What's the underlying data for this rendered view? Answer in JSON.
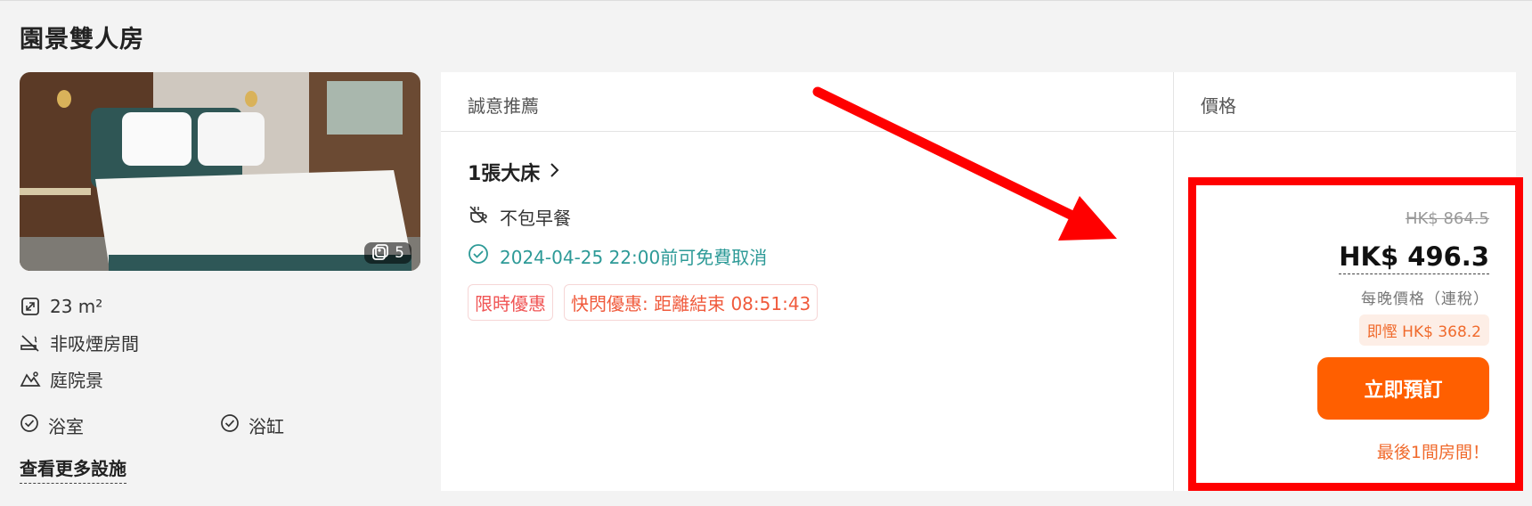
{
  "room": {
    "title": "園景雙人房",
    "photo_count": "5"
  },
  "features": [
    {
      "icon": "area-icon",
      "label": "23 m²"
    },
    {
      "icon": "no-smoking-icon",
      "label": "非吸煙房間"
    },
    {
      "icon": "garden-view-icon",
      "label": "庭院景"
    }
  ],
  "amenities": [
    {
      "icon": "check-circle-icon",
      "label": "浴室"
    },
    {
      "icon": "check-circle-icon",
      "label": "浴缸"
    }
  ],
  "more_facilities_link": "查看更多設施",
  "table": {
    "header_recommend": "誠意推薦",
    "header_price": "價格"
  },
  "offer": {
    "bed": "1張大床",
    "breakfast": "不包早餐",
    "cancellation": "2024-04-25 22:00前可免費取消",
    "badges": [
      "限時優惠",
      "快閃優惠: 距離結束 08:51:43"
    ]
  },
  "pricing": {
    "original": "HK$ 864.5",
    "current": "HK$ 496.3",
    "per_night_note": "每晚價格（連稅）",
    "savings": "即慳 HK$ 368.2",
    "book_button": "立即預訂",
    "availability": "最後1間房間！"
  },
  "colors": {
    "accent": "#ff5f00",
    "teal": "#2d9a97",
    "badge_red": "#f05454",
    "annotation": "#ff0000"
  }
}
